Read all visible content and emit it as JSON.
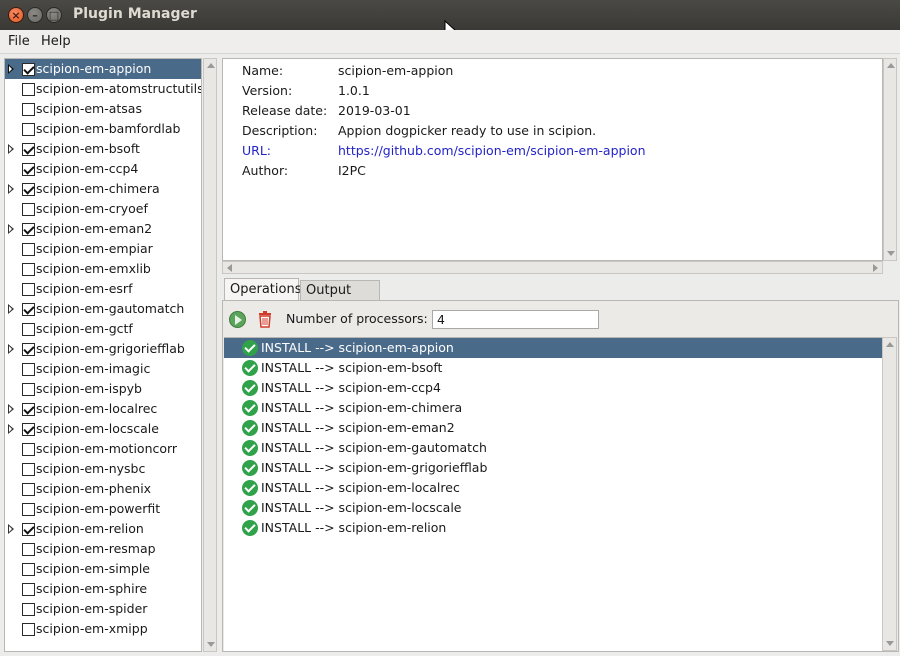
{
  "window": {
    "title": "Plugin Manager"
  },
  "menu": {
    "file": "File",
    "help": "Help"
  },
  "plugins": [
    {
      "name": "scipion-em-appion",
      "checked": true,
      "expandable": true,
      "selected": true
    },
    {
      "name": "scipion-em-atomstructutils",
      "checked": false,
      "expandable": false
    },
    {
      "name": "scipion-em-atsas",
      "checked": false,
      "expandable": false
    },
    {
      "name": "scipion-em-bamfordlab",
      "checked": false,
      "expandable": false
    },
    {
      "name": "scipion-em-bsoft",
      "checked": true,
      "expandable": true
    },
    {
      "name": "scipion-em-ccp4",
      "checked": true,
      "expandable": false
    },
    {
      "name": "scipion-em-chimera",
      "checked": true,
      "expandable": true
    },
    {
      "name": "scipion-em-cryoef",
      "checked": false,
      "expandable": false
    },
    {
      "name": "scipion-em-eman2",
      "checked": true,
      "expandable": true
    },
    {
      "name": "scipion-em-empiar",
      "checked": false,
      "expandable": false
    },
    {
      "name": "scipion-em-emxlib",
      "checked": false,
      "expandable": false
    },
    {
      "name": "scipion-em-esrf",
      "checked": false,
      "expandable": false
    },
    {
      "name": "scipion-em-gautomatch",
      "checked": true,
      "expandable": true
    },
    {
      "name": "scipion-em-gctf",
      "checked": false,
      "expandable": false
    },
    {
      "name": "scipion-em-grigoriefflab",
      "checked": true,
      "expandable": true
    },
    {
      "name": "scipion-em-imagic",
      "checked": false,
      "expandable": false
    },
    {
      "name": "scipion-em-ispyb",
      "checked": false,
      "expandable": false
    },
    {
      "name": "scipion-em-localrec",
      "checked": true,
      "expandable": true
    },
    {
      "name": "scipion-em-locscale",
      "checked": true,
      "expandable": true
    },
    {
      "name": "scipion-em-motioncorr",
      "checked": false,
      "expandable": false
    },
    {
      "name": "scipion-em-nysbc",
      "checked": false,
      "expandable": false
    },
    {
      "name": "scipion-em-phenix",
      "checked": false,
      "expandable": false
    },
    {
      "name": "scipion-em-powerfit",
      "checked": false,
      "expandable": false
    },
    {
      "name": "scipion-em-relion",
      "checked": true,
      "expandable": true
    },
    {
      "name": "scipion-em-resmap",
      "checked": false,
      "expandable": false
    },
    {
      "name": "scipion-em-simple",
      "checked": false,
      "expandable": false
    },
    {
      "name": "scipion-em-sphire",
      "checked": false,
      "expandable": false
    },
    {
      "name": "scipion-em-spider",
      "checked": false,
      "expandable": false
    },
    {
      "name": "scipion-em-xmipp",
      "checked": false,
      "expandable": false
    }
  ],
  "details": {
    "name_label": "Name:",
    "name": "scipion-em-appion",
    "version_label": "Version:",
    "version": "1.0.1",
    "release_label": "Release date:",
    "release": "2019-03-01",
    "description_label": "Description:",
    "description": "Appion dogpicker ready to use in scipion.",
    "url_label": "URL:",
    "url": "https://github.com/scipion-em/scipion-em-appion",
    "author_label": "Author:",
    "author": "I2PC"
  },
  "tabs": {
    "operations": "Operations",
    "output_log": "Output Log"
  },
  "toolbar": {
    "processors_label": "Number of processors:",
    "processors_value": "4"
  },
  "operations": [
    {
      "text": "INSTALL --> scipion-em-appion",
      "selected": true
    },
    {
      "text": "INSTALL --> scipion-em-bsoft"
    },
    {
      "text": "INSTALL --> scipion-em-ccp4"
    },
    {
      "text": "INSTALL --> scipion-em-chimera"
    },
    {
      "text": "INSTALL --> scipion-em-eman2"
    },
    {
      "text": "INSTALL --> scipion-em-gautomatch"
    },
    {
      "text": "INSTALL --> scipion-em-grigoriefflab"
    },
    {
      "text": "INSTALL --> scipion-em-localrec"
    },
    {
      "text": "INSTALL --> scipion-em-locscale"
    },
    {
      "text": "INSTALL --> scipion-em-relion"
    }
  ]
}
